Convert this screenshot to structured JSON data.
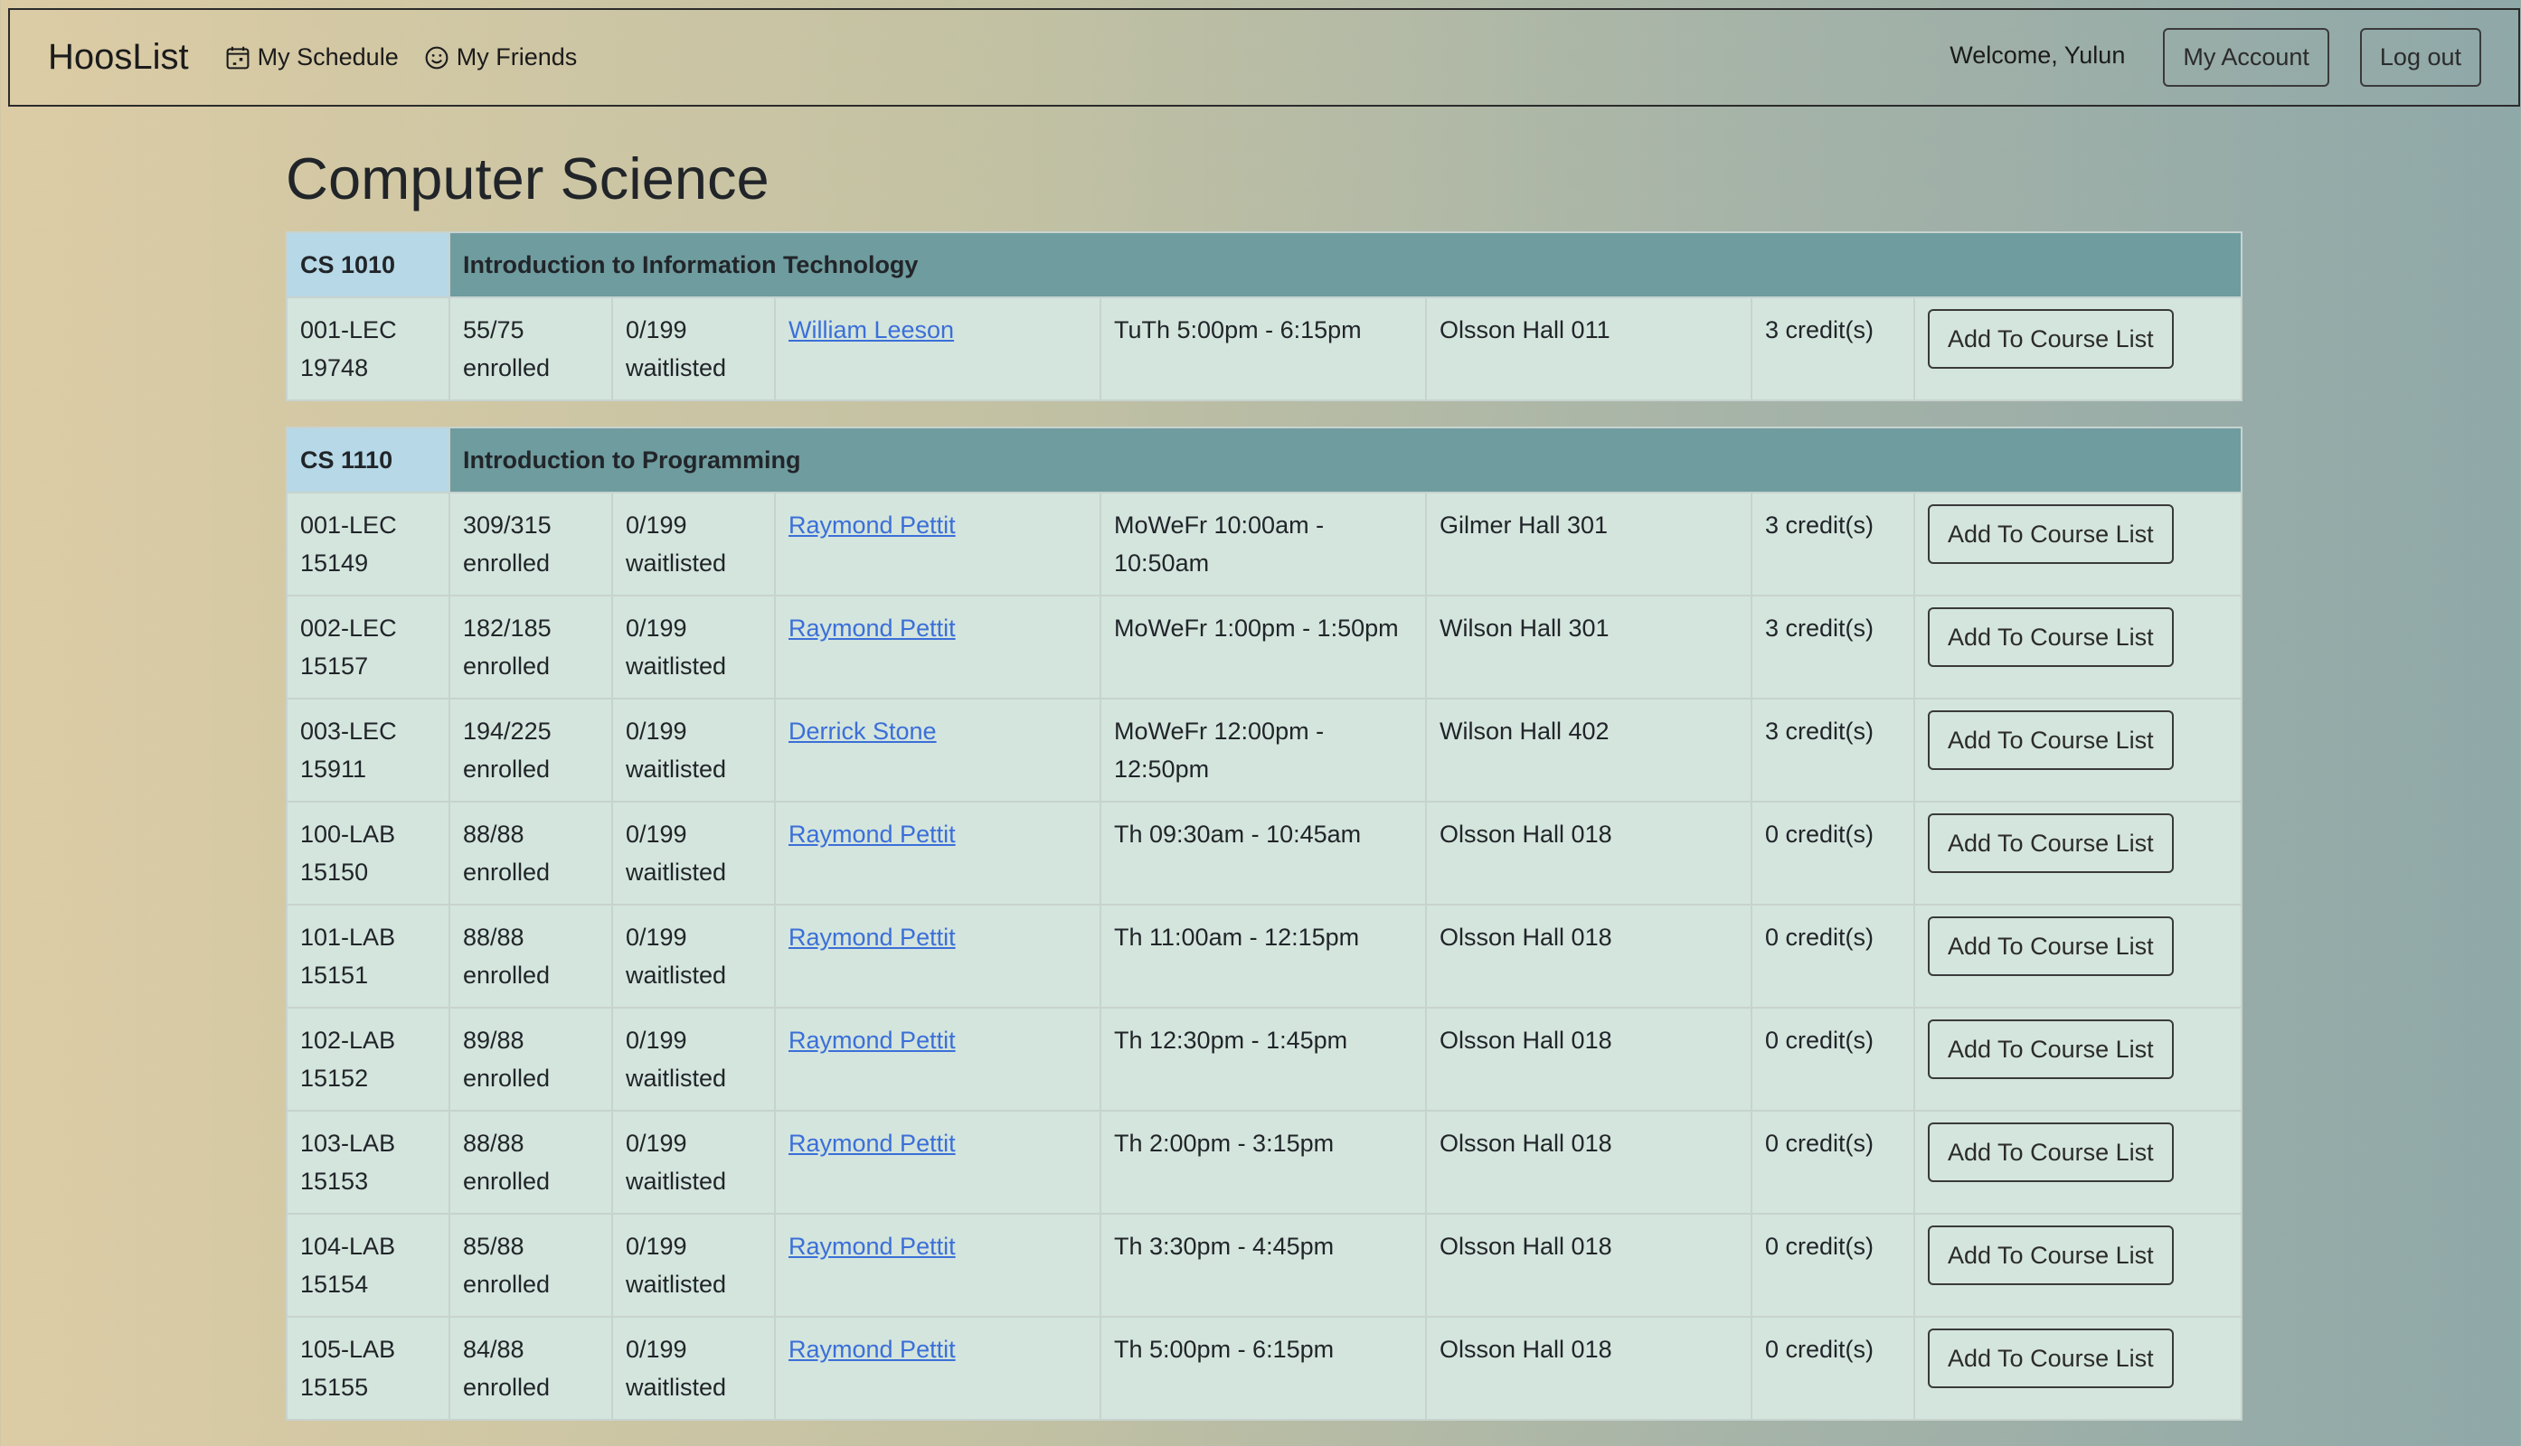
{
  "nav": {
    "brand": "HoosList",
    "links": [
      {
        "label": "My Schedule",
        "icon": "calendar-icon"
      },
      {
        "label": "My Friends",
        "icon": "smiley-icon"
      }
    ],
    "welcome": "Welcome, Yulun",
    "account_label": "My Account",
    "logout_label": "Log out"
  },
  "page_title": "Computer Science",
  "courses": [
    {
      "code": "CS 1010",
      "title": "Introduction to Information Technology",
      "sections": [
        {
          "section": "001-LEC",
          "id": "19748",
          "enrolled": "55/75",
          "enrolled_label": "enrolled",
          "waitlisted": "0/199",
          "waitlist_label": "waitlisted",
          "instructor": "William Leeson",
          "time": "TuTh 5:00pm - 6:15pm",
          "location": "Olsson Hall 011",
          "credits": "3 credit(s)",
          "action": "Add To Course List"
        }
      ]
    },
    {
      "code": "CS 1110",
      "title": "Introduction to Programming",
      "sections": [
        {
          "section": "001-LEC",
          "id": "15149",
          "enrolled": "309/315",
          "enrolled_label": "enrolled",
          "waitlisted": "0/199",
          "waitlist_label": "waitlisted",
          "instructor": "Raymond Pettit",
          "time": "MoWeFr 10:00am - 10:50am",
          "location": "Gilmer Hall 301",
          "credits": "3 credit(s)",
          "action": "Add To Course List"
        },
        {
          "section": "002-LEC",
          "id": "15157",
          "enrolled": "182/185",
          "enrolled_label": "enrolled",
          "waitlisted": "0/199",
          "waitlist_label": "waitlisted",
          "instructor": "Raymond Pettit",
          "time": "MoWeFr 1:00pm - 1:50pm",
          "location": "Wilson Hall 301",
          "credits": "3 credit(s)",
          "action": "Add To Course List"
        },
        {
          "section": "003-LEC",
          "id": "15911",
          "enrolled": "194/225",
          "enrolled_label": "enrolled",
          "waitlisted": "0/199",
          "waitlist_label": "waitlisted",
          "instructor": "Derrick Stone",
          "time": "MoWeFr 12:00pm - 12:50pm",
          "location": "Wilson Hall 402",
          "credits": "3 credit(s)",
          "action": "Add To Course List"
        },
        {
          "section": "100-LAB",
          "id": "15150",
          "enrolled": "88/88",
          "enrolled_label": "enrolled",
          "waitlisted": "0/199",
          "waitlist_label": "waitlisted",
          "instructor": "Raymond Pettit",
          "time": "Th 09:30am - 10:45am",
          "location": "Olsson Hall 018",
          "credits": "0 credit(s)",
          "action": "Add To Course List"
        },
        {
          "section": "101-LAB",
          "id": "15151",
          "enrolled": "88/88",
          "enrolled_label": "enrolled",
          "waitlisted": "0/199",
          "waitlist_label": "waitlisted",
          "instructor": "Raymond Pettit",
          "time": "Th 11:00am - 12:15pm",
          "location": "Olsson Hall 018",
          "credits": "0 credit(s)",
          "action": "Add To Course List"
        },
        {
          "section": "102-LAB",
          "id": "15152",
          "enrolled": "89/88",
          "enrolled_label": "enrolled",
          "waitlisted": "0/199",
          "waitlist_label": "waitlisted",
          "instructor": "Raymond Pettit",
          "time": "Th 12:30pm - 1:45pm",
          "location": "Olsson Hall 018",
          "credits": "0 credit(s)",
          "action": "Add To Course List"
        },
        {
          "section": "103-LAB",
          "id": "15153",
          "enrolled": "88/88",
          "enrolled_label": "enrolled",
          "waitlisted": "0/199",
          "waitlist_label": "waitlisted",
          "instructor": "Raymond Pettit",
          "time": "Th 2:00pm - 3:15pm",
          "location": "Olsson Hall 018",
          "credits": "0 credit(s)",
          "action": "Add To Course List"
        },
        {
          "section": "104-LAB",
          "id": "15154",
          "enrolled": "85/88",
          "enrolled_label": "enrolled",
          "waitlisted": "0/199",
          "waitlist_label": "waitlisted",
          "instructor": "Raymond Pettit",
          "time": "Th 3:30pm - 4:45pm",
          "location": "Olsson Hall 018",
          "credits": "0 credit(s)",
          "action": "Add To Course List"
        },
        {
          "section": "105-LAB",
          "id": "15155",
          "enrolled": "84/88",
          "enrolled_label": "enrolled",
          "waitlisted": "0/199",
          "waitlist_label": "waitlisted",
          "instructor": "Raymond Pettit",
          "time": "Th 5:00pm - 6:15pm",
          "location": "Olsson Hall 018",
          "credits": "0 credit(s)",
          "action": "Add To Course List"
        }
      ]
    }
  ]
}
